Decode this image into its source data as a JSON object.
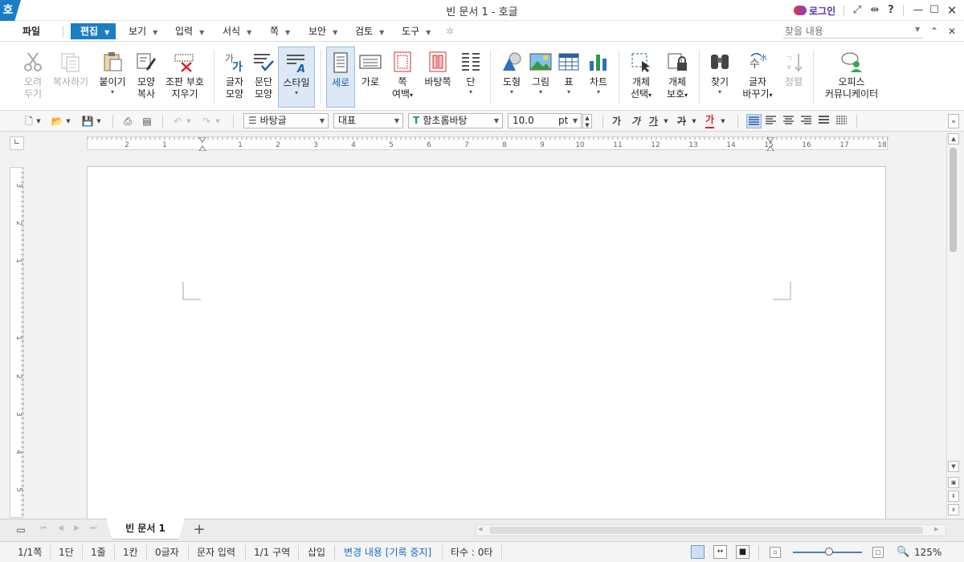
{
  "titlebar": {
    "title": "빈 문서 1 - 호글",
    "app_logo": "호",
    "login_label": "로그인",
    "help_label": "?"
  },
  "menu": {
    "file": "파일",
    "items": [
      "편집",
      "보기",
      "입력",
      "서식",
      "쪽",
      "보안",
      "검토",
      "도구"
    ],
    "active": "편집",
    "search_placeholder": "찾을 내용"
  },
  "ribbon": {
    "buttons": [
      {
        "label1": "오려",
        "label2": "두기",
        "icon": "scissors-icon",
        "disabled": true
      },
      {
        "label1": "복사하기",
        "label2": "",
        "icon": "copy-icon",
        "disabled": true
      },
      {
        "label1": "붙이기",
        "label2": "",
        "icon": "paste-icon",
        "caret": true
      },
      {
        "label1": "모양",
        "label2": "복사",
        "icon": "format-painter-icon"
      },
      {
        "label1": "조판 부호",
        "label2": "지우기",
        "icon": "clear-marks-icon"
      },
      {
        "label1": "글자",
        "label2": "모양",
        "icon": "char-shape-icon"
      },
      {
        "label1": "문단",
        "label2": "모양",
        "icon": "para-shape-icon"
      },
      {
        "label1": "스타일",
        "label2": "",
        "icon": "style-icon",
        "caret": true,
        "selected": true
      },
      {
        "label1": "세로",
        "label2": "",
        "icon": "portrait-icon",
        "selected": true
      },
      {
        "label1": "가로",
        "label2": "",
        "icon": "landscape-icon"
      },
      {
        "label1": "쪽",
        "label2": "여백",
        "icon": "margin-icon",
        "caret2": true
      },
      {
        "label1": "바탕쪽",
        "label2": "",
        "icon": "master-page-icon"
      },
      {
        "label1": "단",
        "label2": "",
        "icon": "columns-icon",
        "caret": true
      },
      {
        "label1": "도형",
        "label2": "",
        "icon": "shape-icon",
        "caret": true
      },
      {
        "label1": "그림",
        "label2": "",
        "icon": "picture-icon",
        "caret": true
      },
      {
        "label1": "표",
        "label2": "",
        "icon": "table-icon",
        "caret": true
      },
      {
        "label1": "차트",
        "label2": "",
        "icon": "chart-icon",
        "caret": true
      },
      {
        "label1": "개체",
        "label2": "선택",
        "icon": "select-object-icon",
        "caret2": true
      },
      {
        "label1": "개체",
        "label2": "보호",
        "icon": "protect-object-icon",
        "caret2": true
      },
      {
        "label1": "찾기",
        "label2": "",
        "icon": "binoculars-icon",
        "caret": true
      },
      {
        "label1": "글자",
        "label2": "바꾸기",
        "icon": "replace-icon",
        "caret2": true
      },
      {
        "label1": "정렬",
        "label2": "",
        "icon": "sort-icon",
        "disabled": true
      },
      {
        "label1": "오피스",
        "label2": "커뮤니케이터",
        "icon": "communicator-icon"
      }
    ]
  },
  "format": {
    "style": "바탕글",
    "lang": "대표",
    "font": "함초롬바탕",
    "size": "10.0",
    "unit": "pt",
    "bold": "가",
    "italic": "가",
    "underline": "가",
    "strike": "가",
    "color_char": "가",
    "font_color": "#e02020"
  },
  "ruler": {
    "h_ticks": [
      "2",
      "1",
      "1",
      "2",
      "3",
      "4",
      "5",
      "6",
      "7",
      "8",
      "9",
      "10",
      "11",
      "12",
      "13",
      "14",
      "15",
      "16",
      "17",
      "18"
    ],
    "v_ticks": [
      "3",
      "2",
      "1",
      "1",
      "2",
      "3",
      "4",
      "5"
    ]
  },
  "tabs": {
    "doc_tab": "빈 문서 1",
    "add": "+"
  },
  "status": {
    "page": "1/1쪽",
    "column": "1단",
    "line": "1줄",
    "col": "1칸",
    "chars": "0글자",
    "mode": "문자 입력",
    "section": "1/1 구역",
    "insert": "삽입",
    "track": "변경 내용 [기록 중지]",
    "keystrokes": "타수 : 0타",
    "zoom": "125%",
    "accent_color": "#1a7ec7"
  }
}
